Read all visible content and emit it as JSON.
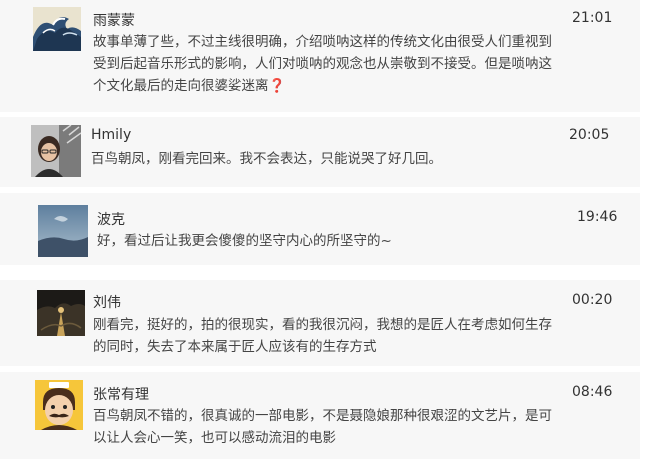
{
  "comments": [
    {
      "name": "雨蒙蒙",
      "time": "21:01",
      "lines": [
        "故事单薄了些，不过主线很明确，介绍唢呐这样的传统文化由很受人们重视到",
        "受到后起音乐形式的影响，人们对唢呐的观念也从崇敬到不接受。但是唢呐这",
        "个文化最后的走向很婆娑迷离"
      ],
      "trailing_symbol": "❓",
      "avatar_icon": "wave-painting-avatar"
    },
    {
      "name": "Hmily",
      "time": "20:05",
      "lines": [
        "百鸟朝凤，刚看完回来。我不会表达，只能说哭了好几回。"
      ],
      "avatar_icon": "person-photo-avatar"
    },
    {
      "name": "波克",
      "time": "19:46",
      "lines": [
        "好，看过后让我更会傻傻的坚守内心的所坚守的~"
      ],
      "avatar_icon": "blue-sky-avatar"
    },
    {
      "name": "刘伟",
      "time": "00:20",
      "lines": [
        "刚看完，挺好的，拍的很现实，看的我很沉闷，我想的是匠人在考虑如何生存",
        "的同时，失去了本来属于匠人应该有的生存方式"
      ],
      "avatar_icon": "dark-landscape-avatar"
    },
    {
      "name": "张常有理",
      "time": "08:46",
      "lines": [
        "百鸟朝凤不错的，很真诚的一部电影，不是聂隐娘那种很艰涩的文艺片，是可",
        "以让人会心一笑，也可以感动流泪的电影"
      ],
      "avatar_icon": "cartoon-mustache-avatar"
    }
  ],
  "colors": {
    "card_bg": "#f7f7f7",
    "page_bg": "#ffffff",
    "text": "#444444",
    "question_mark": "#d03a3a"
  }
}
